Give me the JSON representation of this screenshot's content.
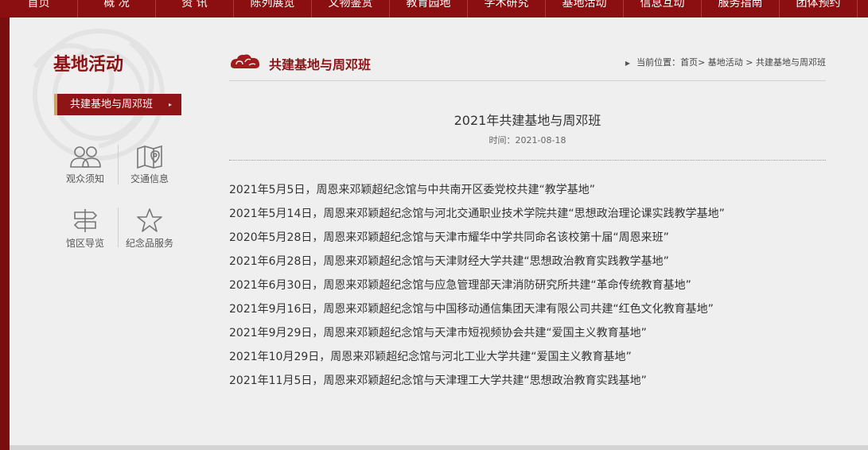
{
  "nav": {
    "items": [
      "首页",
      "概 况",
      "资 讯",
      "陈列展览",
      "文物鉴赏",
      "教育园地",
      "学术研究",
      "基地活动",
      "信息互动",
      "服务指南",
      "团体预约"
    ]
  },
  "sidebar": {
    "title": "基地活动",
    "active_item": "共建基地与周邓班",
    "quick_links": {
      "visitor_notice": "观众须知",
      "traffic_info": "交通信息",
      "area_guide": "馆区导览",
      "souvenir_service": "纪念品服务"
    }
  },
  "content": {
    "section_title": "共建基地与周邓班",
    "breadcrumb": {
      "prefix": "当前位置：",
      "home": "首页",
      "sep": ">",
      "level1": "基地活动",
      "level2": "共建基地与周邓班"
    },
    "article": {
      "title": "2021年共建基地与周邓班",
      "date": "时间：2021-08-18",
      "lines": [
        "2021年5月5日，周恩来邓颖超纪念馆与中共南开区委党校共建“教学基地”",
        "2021年5月14日，周恩来邓颖超纪念馆与河北交通职业技术学院共建“思想政治理论课实践教学基地”",
        "2020年5月28日，周恩来邓颖超纪念馆与天津市耀华中学共同命名该校第十届“周恩来班”",
        "2021年6月28日，周恩来邓颖超纪念馆与天津财经大学共建“思想政治教育实践教学基地”",
        "2021年6月30日，周恩来邓颖超纪念馆与应急管理部天津消防研究所共建“革命传统教育基地”",
        "2021年9月16日，周恩来邓颖超纪念馆与中国移动通信集团天津有限公司共建“红色文化教育基地”",
        "2021年9月29日，周恩来邓颖超纪念馆与天津市短视频协会共建“爱国主义教育基地”",
        "2021年10月29日，周恩来邓颖超纪念馆与河北工业大学共建“爱国主义教育基地”",
        "2021年11月5日，周恩来邓颖超纪念馆与天津理工大学共建“思想政治教育实践基地”"
      ]
    }
  },
  "colors": {
    "brand_red": "#8b0f10",
    "accent_gold": "#c9a56a",
    "page_bg": "#efefef"
  }
}
